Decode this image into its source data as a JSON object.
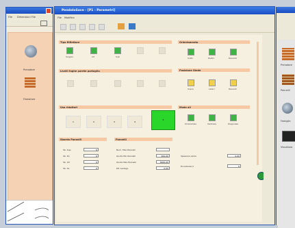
{
  "left_window": {
    "title": "",
    "menu": [
      "File",
      "Dimensioni",
      "File"
    ],
    "items": [
      {
        "label": "Prenotare",
        "icon": "mirror-icon"
      },
      {
        "label": "Finestrare",
        "icon": "brick-icon"
      }
    ]
  },
  "main_window": {
    "title": "PendoloSave - [P1 - Parametri]",
    "menu": [
      "File",
      "Modifica"
    ],
    "groups": {
      "tipo_riflettore": {
        "title": "Tipo Riflettore",
        "buttons": [
          "Singolo",
          "Inf",
          "Sub"
        ]
      },
      "livelli": {
        "title": "Livelli fughe parete portaglio"
      },
      "orientamento": {
        "title": "Orientamento",
        "buttons": [
          "Sotto",
          "Dietro",
          "Davanti"
        ]
      },
      "posizione_stede": {
        "title": "Posizione Stede",
        "buttons": [
          "Sopra",
          "Lateri",
          "Davanti"
        ]
      },
      "uso_riduttori": {
        "title": "Uso riduttori",
        "values": [
          "1",
          "2",
          "3",
          "4",
          "5"
        ]
      },
      "modo_ali": {
        "title": "Modo ali",
        "buttons": [
          "Orizzontale",
          "Verticale",
          "Diagonale"
        ]
      },
      "sbordo": {
        "title": "Sbordo Pannelli",
        "rows": [
          {
            "label": "Sb. Sup.",
            "value": "0"
          },
          {
            "label": "Sb. Dx",
            "value": "0"
          },
          {
            "label": "Sb. Inf.",
            "value": "0"
          },
          {
            "label": "Sb. Sx",
            "value": "0"
          }
        ]
      },
      "pannelli": {
        "title": "Pannelli",
        "rows": [
          {
            "label": "Num. Max Pannelli",
            "value": ""
          },
          {
            "label": "Quota Min Pannelli",
            "value": "200.00"
          },
          {
            "label": "Quota Max Pannelli",
            "value": "3000.00"
          },
          {
            "label": "Rif. Lavtegl.",
            "value": "0.00"
          }
        ]
      },
      "extra": {
        "rows": [
          {
            "label": "Spessore Lama",
            "value": "0.00"
          },
          {
            "label": "Eccedenza X",
            "value": "0"
          }
        ]
      }
    },
    "colors": {
      "accent_green": "#2ad62a",
      "titlebar": "#1a4ec4"
    }
  },
  "right_window": {
    "items": [
      "Prenotare",
      "Pannelli",
      "Famiglie",
      "Visualizza"
    ]
  }
}
